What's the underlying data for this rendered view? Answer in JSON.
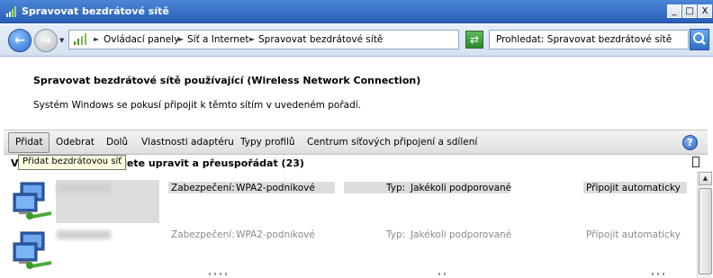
{
  "window": {
    "title": "Spravovat bezdrátové sítě",
    "controls": [
      "_",
      "□",
      "X"
    ]
  },
  "address": {
    "breadcrumb": [
      "Ovládací panely",
      "Síť a Internet",
      "Spravovat bezdrátové sítě"
    ],
    "search_text": "Prohledat: Spravovat bezdrátové sítě"
  },
  "header": {
    "title": "Spravovat bezdrátové sítě používající (Wireless Network Connection)",
    "description": "Systém Windows se pokusí připojit k těmto sítím v uvedeném pořadí."
  },
  "toolbar": {
    "items": [
      "Přidat",
      "Odebrat",
      "Dolů",
      "Vlastnosti adaptéru",
      "Typy profilů",
      "Centrum síťových připojení a sdílení"
    ],
    "help": "?"
  },
  "list": {
    "heading_visible": "žete upravit a přeuspořádat (23)",
    "heading_prefix": "V",
    "tooltip": "Přidat bezdrátovou síť",
    "rows": [
      {
        "security_label": "Zabezpečení:",
        "security_value": "WPA2-podnikové",
        "type_label": "Typ:",
        "type_value": "Jakékoli podporované",
        "connect": "Připojit automaticky"
      },
      {
        "security_label": "Zabezpečení:",
        "security_value": "WPA2-podnikové",
        "type_label": "Typ:",
        "type_value": "Jakékoli podporované",
        "connect": "Připojit automaticky"
      }
    ]
  },
  "colors": {
    "titlebar": "#2a5fb8",
    "toolbar": "#e6e6e6",
    "selection": "#dcdcdc"
  }
}
